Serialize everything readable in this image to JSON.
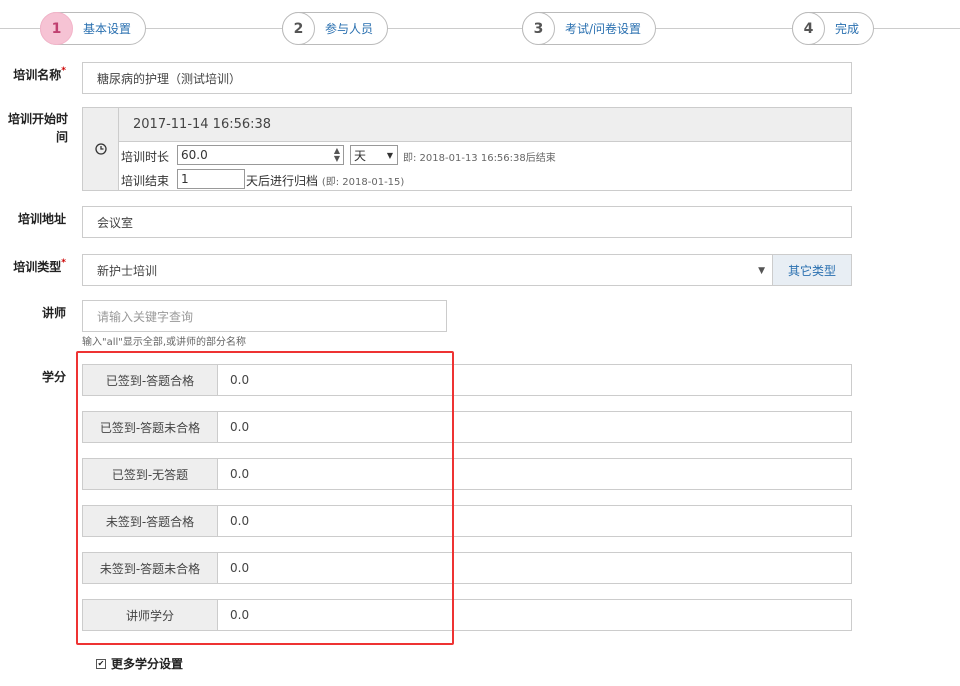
{
  "steps": [
    {
      "num": "1",
      "label": "基本设置"
    },
    {
      "num": "2",
      "label": "参与人员"
    },
    {
      "num": "3",
      "label": "考试/问卷设置"
    },
    {
      "num": "4",
      "label": "完成"
    }
  ],
  "form": {
    "name_label": "培训名称",
    "name_value": "糖尿病的护理（测试培训）",
    "start_label_1": "培训开始时",
    "start_label_2": "间",
    "start_value": "2017-11-14 16:56:38",
    "duration_label": "培训时长",
    "duration_value": "60.0",
    "duration_unit": "天",
    "duration_note": "即: 2018-01-13 16:56:38后结束",
    "end_label": "培训结束",
    "end_value": "1",
    "end_suffix": "天后进行归档",
    "end_note": "(即: 2018-01-15)",
    "address_label": "培训地址",
    "address_value": "会议室",
    "type_label": "培训类型",
    "type_value": "新护士培训",
    "type_other_button": "其它类型",
    "teacher_label": "讲师",
    "teacher_placeholder": "请输入关键字查询",
    "teacher_hint": "输入\"all\"显示全部,或讲师的部分名称",
    "credit_label": "学分",
    "required_mark": "*"
  },
  "credits": [
    {
      "label": "已签到-答题合格",
      "value": "0.0"
    },
    {
      "label": "已签到-答题未合格",
      "value": "0.0"
    },
    {
      "label": "已签到-无答题",
      "value": "0.0"
    },
    {
      "label": "未签到-答题合格",
      "value": "0.0"
    },
    {
      "label": "未签到-答题未合格",
      "value": "0.0"
    },
    {
      "label": "讲师学分",
      "value": "0.0"
    }
  ],
  "more_credit": "更多学分设置",
  "colors": {
    "active_step": "#f6c3d4",
    "highlight_frame": "#ee3333",
    "link": "#2a70b0"
  }
}
